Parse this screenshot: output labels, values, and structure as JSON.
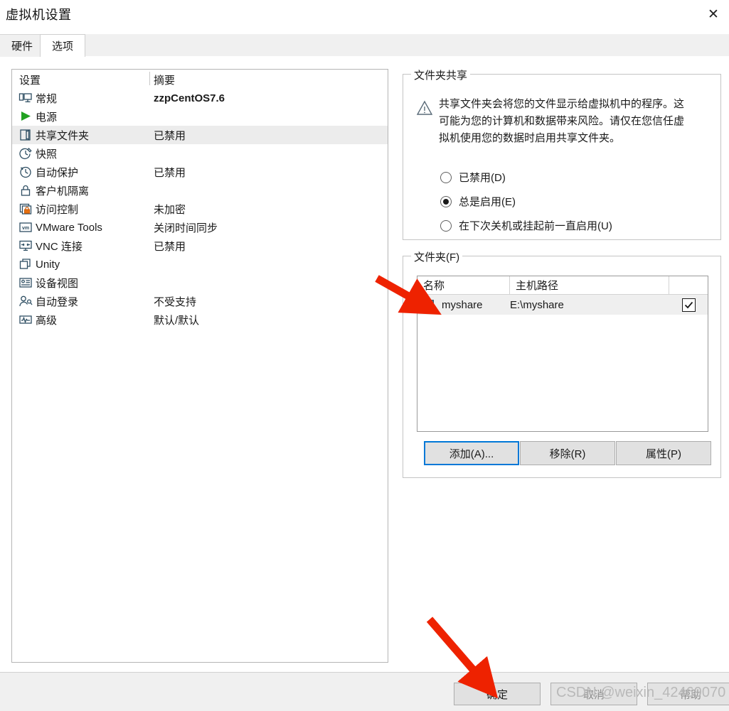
{
  "window": {
    "title": "虚拟机设置",
    "close_icon": "close-icon"
  },
  "tabs": [
    {
      "label": "硬件",
      "active": false
    },
    {
      "label": "选项",
      "active": true
    }
  ],
  "settings_list": {
    "columns": {
      "settings": "设置",
      "summary": "摘要"
    },
    "items": [
      {
        "icon": "monitor-icon",
        "label": "常规",
        "summary": "zzpCentOS7.6",
        "bold": true,
        "selected": false
      },
      {
        "icon": "power-play-icon",
        "label": "电源",
        "summary": "",
        "bold": false,
        "selected": false
      },
      {
        "icon": "shared-folder-icon",
        "label": "共享文件夹",
        "summary": "已禁用",
        "bold": false,
        "selected": true
      },
      {
        "icon": "snapshot-icon",
        "label": "快照",
        "summary": "",
        "bold": false,
        "selected": false
      },
      {
        "icon": "autoprotect-icon",
        "label": "自动保护",
        "summary": "已禁用",
        "bold": false,
        "selected": false
      },
      {
        "icon": "lock-icon",
        "label": "客户机隔离",
        "summary": "",
        "bold": false,
        "selected": false
      },
      {
        "icon": "access-control-icon",
        "label": "访问控制",
        "summary": "未加密",
        "bold": false,
        "selected": false
      },
      {
        "icon": "vmware-tools-icon",
        "label": "VMware Tools",
        "summary": "关闭时间同步",
        "bold": false,
        "selected": false
      },
      {
        "icon": "vnc-icon",
        "label": "VNC 连接",
        "summary": "已禁用",
        "bold": false,
        "selected": false
      },
      {
        "icon": "unity-icon",
        "label": "Unity",
        "summary": "",
        "bold": false,
        "selected": false
      },
      {
        "icon": "device-view-icon",
        "label": "设备视图",
        "summary": "",
        "bold": false,
        "selected": false
      },
      {
        "icon": "autologin-icon",
        "label": "自动登录",
        "summary": "不受支持",
        "bold": false,
        "selected": false
      },
      {
        "icon": "advanced-icon",
        "label": "高级",
        "summary": "默认/默认",
        "bold": false,
        "selected": false
      }
    ]
  },
  "folder_sharing": {
    "group_title": "文件夹共享",
    "warning_icon": "warning-triangle-icon",
    "warning_text": "共享文件夹会将您的文件显示给虚拟机中的程序。这可能为您的计算机和数据带来风险。请仅在您信任虚拟机使用您的数据时启用共享文件夹。",
    "options": [
      {
        "label": "已禁用(D)",
        "checked": false
      },
      {
        "label": "总是启用(E)",
        "checked": true
      },
      {
        "label": "在下次关机或挂起前一直启用(U)",
        "checked": false
      }
    ]
  },
  "folders": {
    "group_title": "文件夹(F)",
    "columns": [
      "名称",
      "主机路径",
      ""
    ],
    "rows": [
      {
        "icon": "folder-icon",
        "name": "myshare",
        "host_path": "E:\\myshare",
        "enabled": true
      }
    ],
    "buttons": {
      "add": "添加(A)...",
      "remove": "移除(R)",
      "properties": "属性(P)"
    }
  },
  "footer": {
    "ok": "确定",
    "cancel": "取消",
    "help": "帮助"
  },
  "watermark": {
    "text": "CSDN @weixin_42469070"
  },
  "colors": {
    "accent_blue": "#0078d7",
    "annotation_red": "#ee2200",
    "selected_row": "#ececec",
    "green_play": "#21a121"
  }
}
